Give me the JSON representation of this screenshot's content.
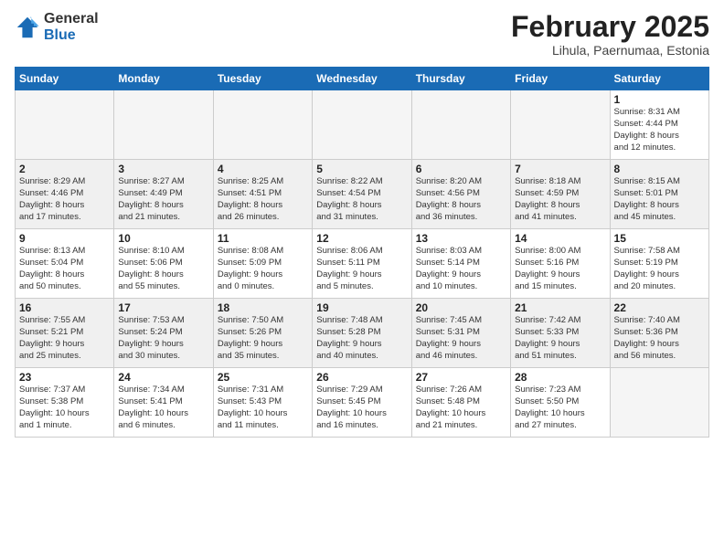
{
  "logo": {
    "general": "General",
    "blue": "Blue"
  },
  "title": "February 2025",
  "subtitle": "Lihula, Paernumaa, Estonia",
  "weekdays": [
    "Sunday",
    "Monday",
    "Tuesday",
    "Wednesday",
    "Thursday",
    "Friday",
    "Saturday"
  ],
  "weeks": [
    [
      {
        "day": "",
        "info": ""
      },
      {
        "day": "",
        "info": ""
      },
      {
        "day": "",
        "info": ""
      },
      {
        "day": "",
        "info": ""
      },
      {
        "day": "",
        "info": ""
      },
      {
        "day": "",
        "info": ""
      },
      {
        "day": "1",
        "info": "Sunrise: 8:31 AM\nSunset: 4:44 PM\nDaylight: 8 hours\nand 12 minutes."
      }
    ],
    [
      {
        "day": "2",
        "info": "Sunrise: 8:29 AM\nSunset: 4:46 PM\nDaylight: 8 hours\nand 17 minutes."
      },
      {
        "day": "3",
        "info": "Sunrise: 8:27 AM\nSunset: 4:49 PM\nDaylight: 8 hours\nand 21 minutes."
      },
      {
        "day": "4",
        "info": "Sunrise: 8:25 AM\nSunset: 4:51 PM\nDaylight: 8 hours\nand 26 minutes."
      },
      {
        "day": "5",
        "info": "Sunrise: 8:22 AM\nSunset: 4:54 PM\nDaylight: 8 hours\nand 31 minutes."
      },
      {
        "day": "6",
        "info": "Sunrise: 8:20 AM\nSunset: 4:56 PM\nDaylight: 8 hours\nand 36 minutes."
      },
      {
        "day": "7",
        "info": "Sunrise: 8:18 AM\nSunset: 4:59 PM\nDaylight: 8 hours\nand 41 minutes."
      },
      {
        "day": "8",
        "info": "Sunrise: 8:15 AM\nSunset: 5:01 PM\nDaylight: 8 hours\nand 45 minutes."
      }
    ],
    [
      {
        "day": "9",
        "info": "Sunrise: 8:13 AM\nSunset: 5:04 PM\nDaylight: 8 hours\nand 50 minutes."
      },
      {
        "day": "10",
        "info": "Sunrise: 8:10 AM\nSunset: 5:06 PM\nDaylight: 8 hours\nand 55 minutes."
      },
      {
        "day": "11",
        "info": "Sunrise: 8:08 AM\nSunset: 5:09 PM\nDaylight: 9 hours\nand 0 minutes."
      },
      {
        "day": "12",
        "info": "Sunrise: 8:06 AM\nSunset: 5:11 PM\nDaylight: 9 hours\nand 5 minutes."
      },
      {
        "day": "13",
        "info": "Sunrise: 8:03 AM\nSunset: 5:14 PM\nDaylight: 9 hours\nand 10 minutes."
      },
      {
        "day": "14",
        "info": "Sunrise: 8:00 AM\nSunset: 5:16 PM\nDaylight: 9 hours\nand 15 minutes."
      },
      {
        "day": "15",
        "info": "Sunrise: 7:58 AM\nSunset: 5:19 PM\nDaylight: 9 hours\nand 20 minutes."
      }
    ],
    [
      {
        "day": "16",
        "info": "Sunrise: 7:55 AM\nSunset: 5:21 PM\nDaylight: 9 hours\nand 25 minutes."
      },
      {
        "day": "17",
        "info": "Sunrise: 7:53 AM\nSunset: 5:24 PM\nDaylight: 9 hours\nand 30 minutes."
      },
      {
        "day": "18",
        "info": "Sunrise: 7:50 AM\nSunset: 5:26 PM\nDaylight: 9 hours\nand 35 minutes."
      },
      {
        "day": "19",
        "info": "Sunrise: 7:48 AM\nSunset: 5:28 PM\nDaylight: 9 hours\nand 40 minutes."
      },
      {
        "day": "20",
        "info": "Sunrise: 7:45 AM\nSunset: 5:31 PM\nDaylight: 9 hours\nand 46 minutes."
      },
      {
        "day": "21",
        "info": "Sunrise: 7:42 AM\nSunset: 5:33 PM\nDaylight: 9 hours\nand 51 minutes."
      },
      {
        "day": "22",
        "info": "Sunrise: 7:40 AM\nSunset: 5:36 PM\nDaylight: 9 hours\nand 56 minutes."
      }
    ],
    [
      {
        "day": "23",
        "info": "Sunrise: 7:37 AM\nSunset: 5:38 PM\nDaylight: 10 hours\nand 1 minute."
      },
      {
        "day": "24",
        "info": "Sunrise: 7:34 AM\nSunset: 5:41 PM\nDaylight: 10 hours\nand 6 minutes."
      },
      {
        "day": "25",
        "info": "Sunrise: 7:31 AM\nSunset: 5:43 PM\nDaylight: 10 hours\nand 11 minutes."
      },
      {
        "day": "26",
        "info": "Sunrise: 7:29 AM\nSunset: 5:45 PM\nDaylight: 10 hours\nand 16 minutes."
      },
      {
        "day": "27",
        "info": "Sunrise: 7:26 AM\nSunset: 5:48 PM\nDaylight: 10 hours\nand 21 minutes."
      },
      {
        "day": "28",
        "info": "Sunrise: 7:23 AM\nSunset: 5:50 PM\nDaylight: 10 hours\nand 27 minutes."
      },
      {
        "day": "",
        "info": ""
      }
    ]
  ]
}
